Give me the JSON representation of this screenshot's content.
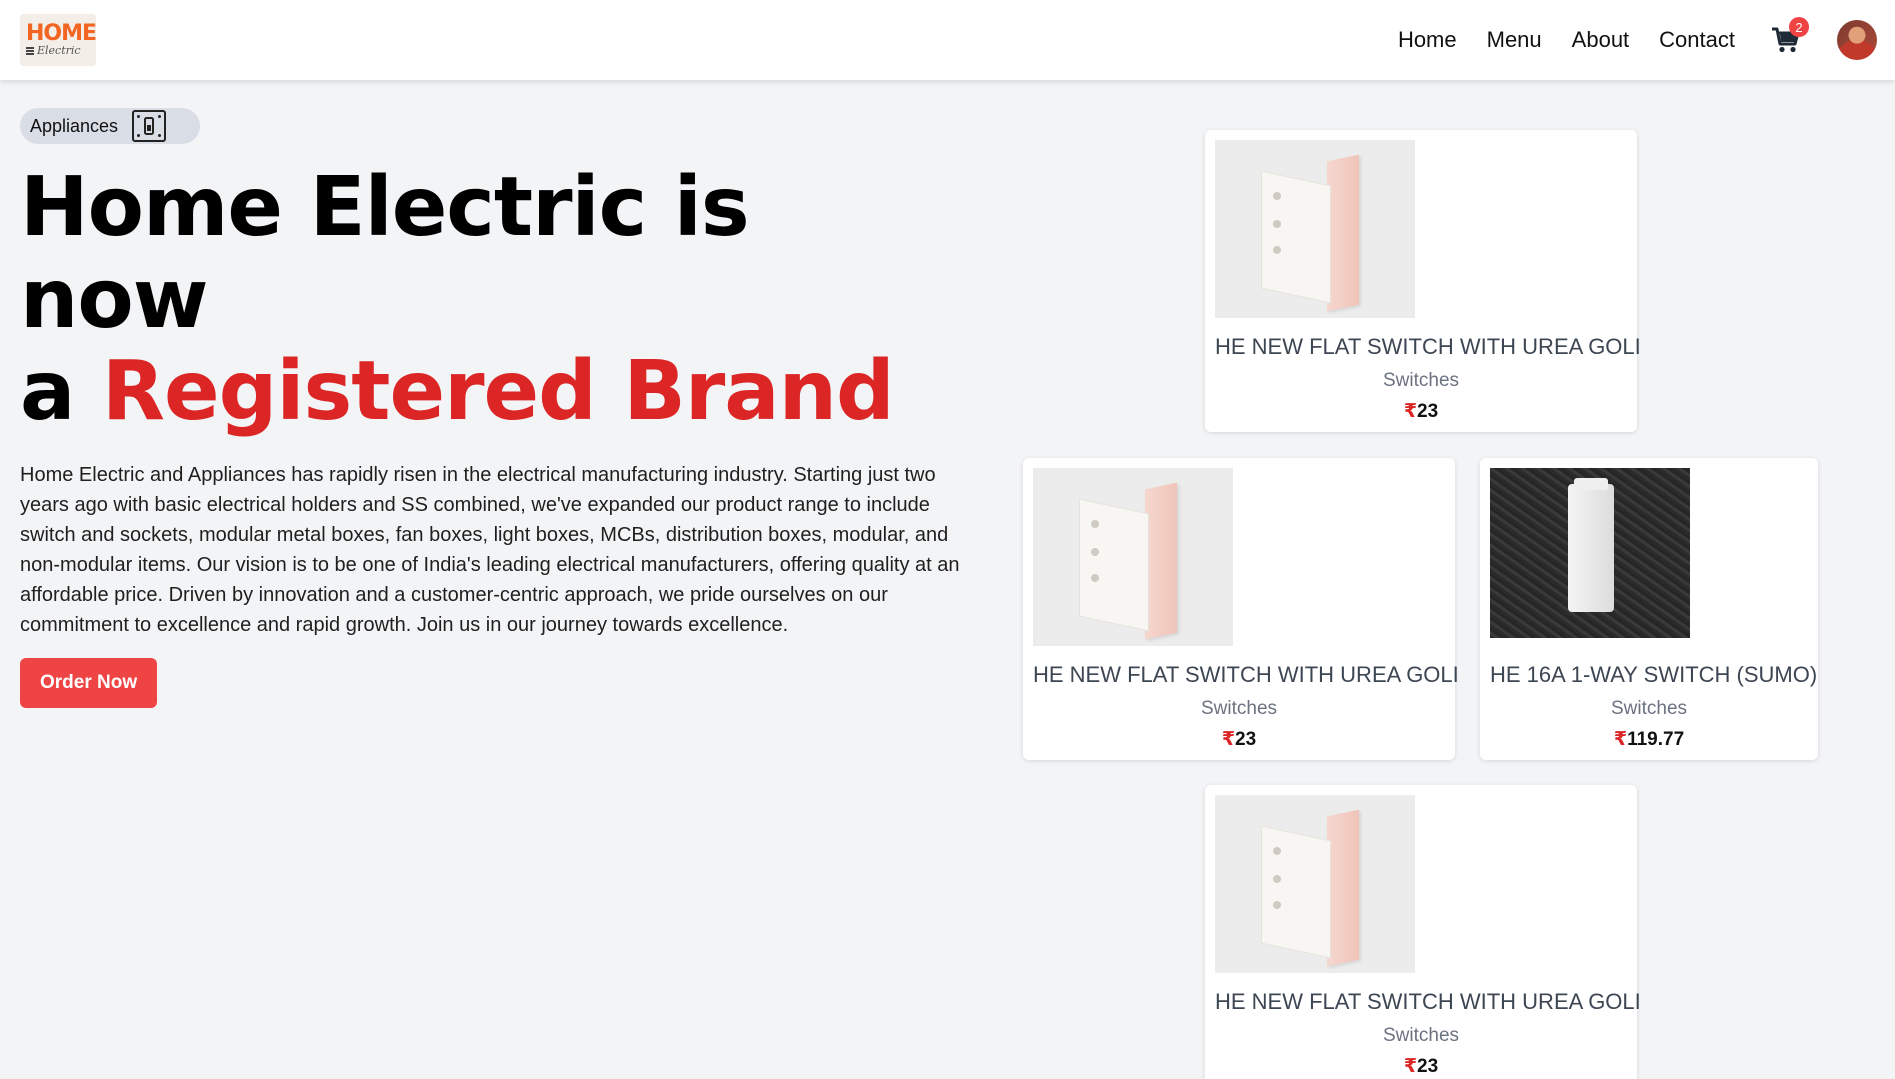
{
  "navbar": {
    "logo_top": "HOME",
    "logo_bottom": "Electric",
    "links": [
      "Home",
      "Menu",
      "About",
      "Contact"
    ],
    "cart_icon": "cart-icon",
    "cart_count": "2",
    "avatar": "user-avatar"
  },
  "hero": {
    "pill_text": "Appliances",
    "pill_icon": "switch-icon",
    "headline_part1": "Home Electric is now",
    "headline_part2": "a ",
    "headline_highlight": "Registered Brand",
    "description": "Home Electric and Appliances has rapidly risen in the electrical manufacturing industry. Starting just two years ago with basic electrical holders and SS combined, we've expanded our product range to include switch and sockets, modular metal boxes, fan boxes, light boxes, MCBs, distribution boxes, modular, and non-modular items. Our vision is to be one of India's leading electrical manufacturers, offering quality at an affordable price. Driven by innovation and a customer-centric approach, we pride ourselves on our commitment to excellence and rapid growth. Join us in our journey towards excellence.",
    "button_label": "Order Now"
  },
  "products": [
    {
      "name": "HE NEW FLAT SWITCH WITH UREA GOLI",
      "category": "Switches",
      "currency": "₹",
      "price": "23"
    },
    {
      "name": "HE NEW FLAT SWITCH WITH UREA GOLI",
      "category": "Switches",
      "currency": "₹",
      "price": "23"
    },
    {
      "name": "HE 16A 1-WAY SWITCH (SUMO)",
      "category": "Switches",
      "currency": "₹",
      "price": "119.77"
    },
    {
      "name": "HE NEW FLAT SWITCH WITH UREA GOLI",
      "category": "Switches",
      "currency": "₹",
      "price": "23"
    }
  ],
  "colors": {
    "accent_red": "#dc2626",
    "button_red": "#ef4444",
    "background": "#f3f4f6"
  }
}
